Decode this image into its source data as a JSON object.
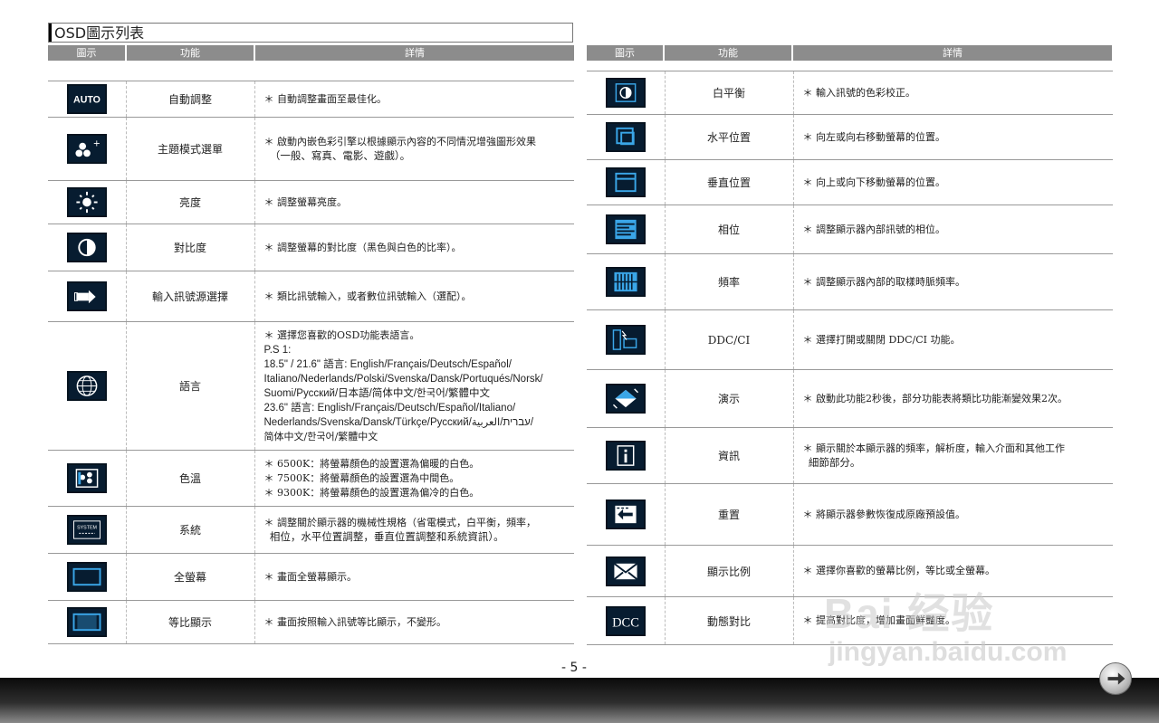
{
  "page": {
    "title": "OSD圖示列表",
    "page_number": "- 5 -"
  },
  "header": {
    "col_icon": "圖示",
    "col_function": "功能",
    "col_details": "詳情"
  },
  "left_rows": [
    {
      "icon": "auto-icon",
      "function": "自動調整",
      "details": [
        "＊ 自動調整畫面至最佳化。"
      ]
    },
    {
      "icon": "theme-mode-icon",
      "function": "主題模式選單",
      "details": [
        "＊ 啟動內嵌色彩引擎以根據顯示內容的不同情況增強圖形效果",
        "  （一般、寫真、電影、遊戲）。"
      ]
    },
    {
      "icon": "brightness-icon",
      "function": "亮度",
      "details": [
        "＊ 調整螢幕亮度。"
      ]
    },
    {
      "icon": "contrast-icon",
      "function": "對比度",
      "details": [
        "＊ 調整螢幕的對比度（黑色與白色的比率）。"
      ]
    },
    {
      "icon": "input-source-icon",
      "function": "輸入訊號源選擇",
      "details": [
        "＊ 類比訊號輸入，或者數位訊號輸入（選配）。"
      ]
    },
    {
      "icon": "language-globe-icon",
      "function": "語言",
      "details": [
        "＊ 選擇您喜歡的OSD功能表語言。",
        "P.S 1:",
        "18.5\" / 21.6\" 語言: English/Français/Deutsch/Español/",
        "Italiano/Nederlands/Polski/Svenska/Dansk/Portuqués/Norsk/",
        "Suomi/Русский/日本語/简体中文/한국어/繁體中文",
        "23.6\" 語言: English/Français/Deutsch/Español/Italiano/",
        "Nederlands/Svenska/Dansk/Türkçe/Русский/עברית/العربية/",
        "简体中文/한국어/繁體中文"
      ]
    },
    {
      "icon": "color-temp-icon",
      "function": "色溫",
      "details": [
        "＊ 6500K：將螢幕顏色的設置選為偏暖的白色。",
        "＊ 7500K：將螢幕顏色的設置選為中間色。",
        "＊ 9300K：將螢幕顏色的設置選為偏冷的白色。"
      ]
    },
    {
      "icon": "system-icon",
      "icon_text": "SYSTEM",
      "function": "系統",
      "details": [
        "＊ 調整關於顯示器的機械性規格（省電模式，白平衡，頻率，",
        "  相位，水平位置調整，垂直位置調整和系統資訊）。"
      ]
    },
    {
      "icon": "full-screen-icon",
      "function": "全螢幕",
      "details": [
        "＊ 畫面全螢幕顯示。"
      ]
    },
    {
      "icon": "aspect-ratio-icon",
      "function": "等比顯示",
      "details": [
        "＊ 畫面按照輸入訊號等比顯示，不變形。"
      ]
    }
  ],
  "right_rows": [
    {
      "icon": "white-balance-icon",
      "function": "白平衡",
      "details": [
        "＊ 輸入訊號的色彩校正。"
      ]
    },
    {
      "icon": "h-position-icon",
      "function": "水平位置",
      "details": [
        "＊ 向左或向右移動螢幕的位置。"
      ]
    },
    {
      "icon": "v-position-icon",
      "function": "垂直位置",
      "details": [
        "＊ 向上或向下移動螢幕的位置。"
      ]
    },
    {
      "icon": "phase-icon",
      "function": "相位",
      "details": [
        "＊ 調整顯示器內部訊號的相位。"
      ]
    },
    {
      "icon": "frequency-icon",
      "function": "頻率",
      "details": [
        "＊ 調整顯示器內部的取樣時脈頻率。"
      ]
    },
    {
      "icon": "ddc-ci-icon",
      "function": "DDC/CI",
      "details": [
        "＊ 選擇打開或關閉 DDC/CI 功能。"
      ]
    },
    {
      "icon": "demo-icon",
      "function": "演示",
      "details": [
        "＊ 啟動此功能2秒後，部分功能表將類比功能漸變效果2次。"
      ]
    },
    {
      "icon": "info-icon",
      "function": "資訊",
      "details": [
        "＊ 顯示關於本顯示器的頻率，解析度，輸入介面和其他工作",
        "  細節部分。"
      ]
    },
    {
      "icon": "reset-icon",
      "function": "重置",
      "details": [
        "＊ 將顯示器參數恢復成原廠預設值。"
      ]
    },
    {
      "icon": "display-ratio-icon",
      "function": "顯示比例",
      "details": [
        "＊ 選擇你喜歡的螢幕比例，等比或全螢幕。"
      ]
    },
    {
      "icon": "dcc-icon",
      "icon_text": "DCC",
      "function": "動態對比",
      "details": [
        "＊ 提高對比度，增加畫面鮮豔度。"
      ]
    }
  ],
  "watermark": {
    "line1": "Bai 经验",
    "line2": "jingyan.baidu.com"
  },
  "colors": {
    "icon_bg": "#071c30",
    "icon_accent": "#3aa6e8",
    "header_bg": "#8c8c8c",
    "footer": "#1a1a1a"
  }
}
